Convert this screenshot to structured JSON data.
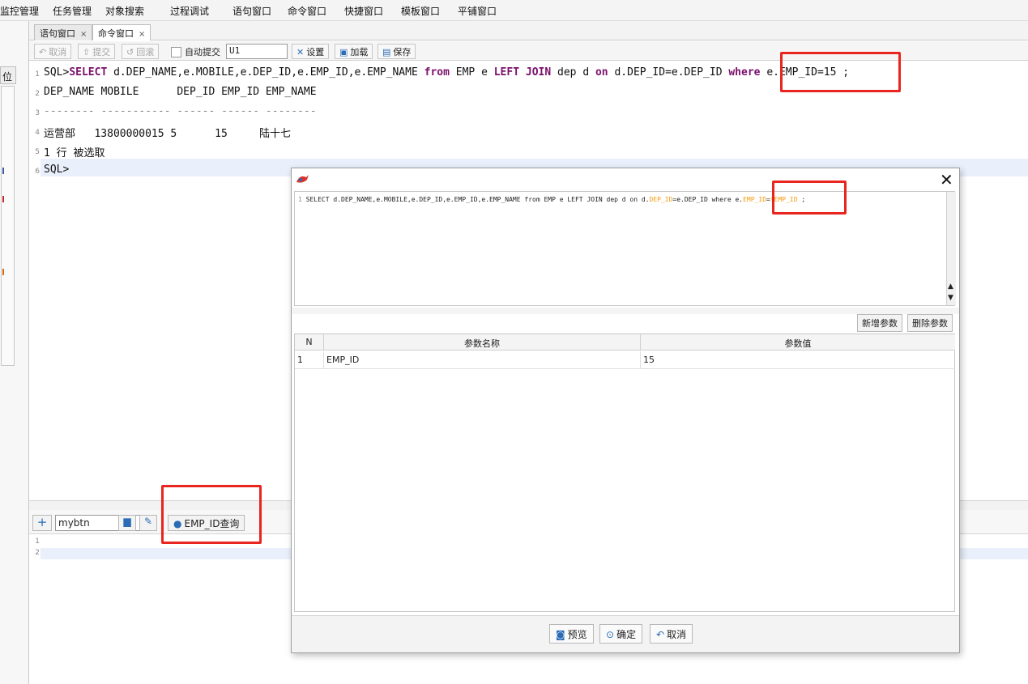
{
  "menu": [
    "监控管理",
    "任务管理",
    "对象搜索",
    "过程调试",
    "语句窗口",
    "命令窗口",
    "快捷窗口",
    "模板窗口",
    "平铺窗口"
  ],
  "left": {
    "tab_label": "位"
  },
  "tabs": [
    {
      "label": "语句窗口",
      "close": "×"
    },
    {
      "label": "命令窗口",
      "close": "×"
    }
  ],
  "toolbar": {
    "cancel": "取消",
    "commit": "提交",
    "rollback": "回滚",
    "autocommit": "自动提交",
    "schema": "U1",
    "settings": "设置",
    "load": "加载",
    "save": "保存"
  },
  "editor": {
    "gutter": [
      "1",
      "2",
      "3",
      "4",
      "5",
      "6"
    ],
    "line1": {
      "prompt": "SQL>",
      "kw_select": "SELECT",
      "t1": " d.DEP_NAME,e.MOBILE,e.DEP_ID,e.EMP_ID,e.EMP_NAME ",
      "kw_from": "from",
      "t2": " EMP e ",
      "kw_left_join": "LEFT JOIN",
      "t3": " dep d ",
      "kw_on": "on",
      "t4": " d.DEP_ID=e.DEP_ID ",
      "kw_where": "where",
      "t5": " e.EMP_ID=15 ;"
    },
    "line2": "DEP_NAME MOBILE      DEP_ID EMP_ID EMP_NAME",
    "line3": "-------- ----------- ------ ------ --------",
    "line4": "运营部   13800000015 5      15     陆十七",
    "line5": "1 行 被选取",
    "line6": "SQL>"
  },
  "bottom": {
    "add": "+",
    "button_name": "mybtn",
    "delete_icon": "trash-icon",
    "edit_icon": "pencil-icon",
    "query_button": "EMP_ID查询",
    "gutter": [
      "1",
      "2"
    ]
  },
  "dialog": {
    "close": "✕",
    "sql": {
      "gutter": "1",
      "s1": "SELECT d.DEP_NAME,e.MOBILE,e.DEP_ID,e.EMP_ID,e.EMP_NAME from EMP e LEFT JOIN dep d on d.",
      "o1": "DEP_ID",
      "s2": "=e.DEP_ID where e.",
      "o2": "EMP_ID",
      "s3": "=",
      "o3": "$EMP_ID",
      "s4": " ;"
    },
    "add_param": "新增参数",
    "delete_param": "删除参数",
    "table": {
      "headers": [
        "N",
        "参数名称",
        "参数值"
      ],
      "rows": [
        [
          "1",
          "EMP_ID",
          "15"
        ]
      ]
    },
    "footer": {
      "preview": "预览",
      "ok": "确定",
      "cancel": "取消"
    }
  },
  "colors": {
    "highlight": "#e8251e",
    "keyword": "#7a0f6b",
    "param": "#f39b11"
  }
}
